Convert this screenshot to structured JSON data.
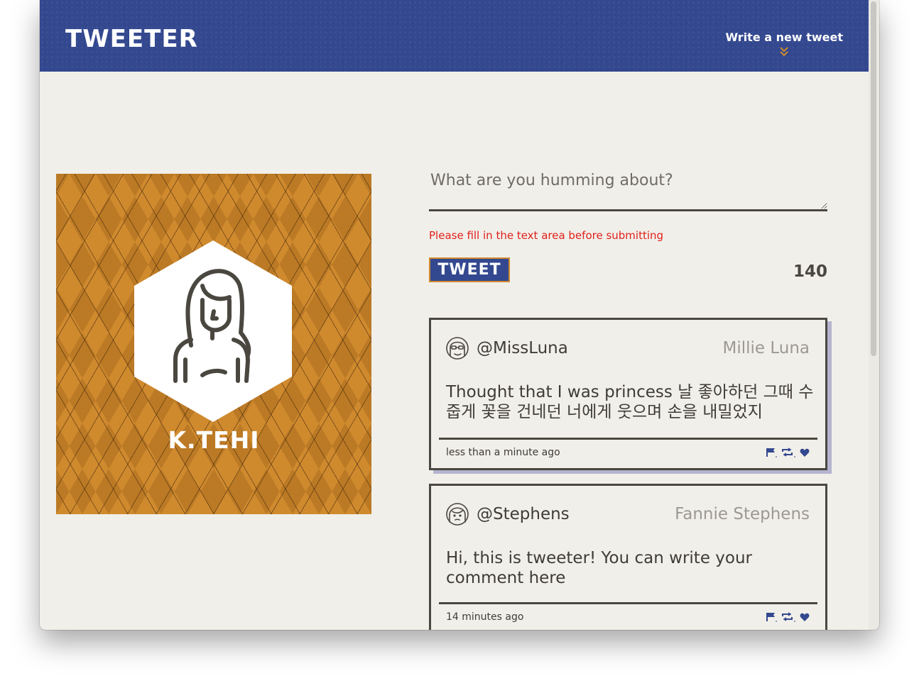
{
  "header": {
    "brand": "TWEETER",
    "compose_toggle": "Write a new tweet",
    "chevron_icon": "double-chevron-down-icon",
    "accent_color": "#d08a2e",
    "navbar_color": "#33488f"
  },
  "profile": {
    "name": "K.TEHI",
    "avatar_icon": "woman-avatar-icon"
  },
  "compose": {
    "placeholder": "What are you humming about?",
    "error": "Please fill in the text area before submitting",
    "button_label": "TWEET",
    "counter": "140"
  },
  "tweets": [
    {
      "handle": "@MissLuna",
      "name": "Millie Luna",
      "content": "Thought that I was princess 날 좋아하던 그때 수줍게 꽃을 건네던 너에게 웃으며 손을 내밀었지",
      "time": "less than a minute ago",
      "avatar_icon": "girl-glasses-avatar-icon"
    },
    {
      "handle": "@Stephens",
      "name": "Fannie Stephens",
      "content": "Hi, this is tweeter! You can write your comment here",
      "time": "14 minutes ago",
      "avatar_icon": "woman-avatar-icon"
    }
  ],
  "actions": [
    "flag-icon",
    "retweet-icon",
    "heart-icon"
  ]
}
